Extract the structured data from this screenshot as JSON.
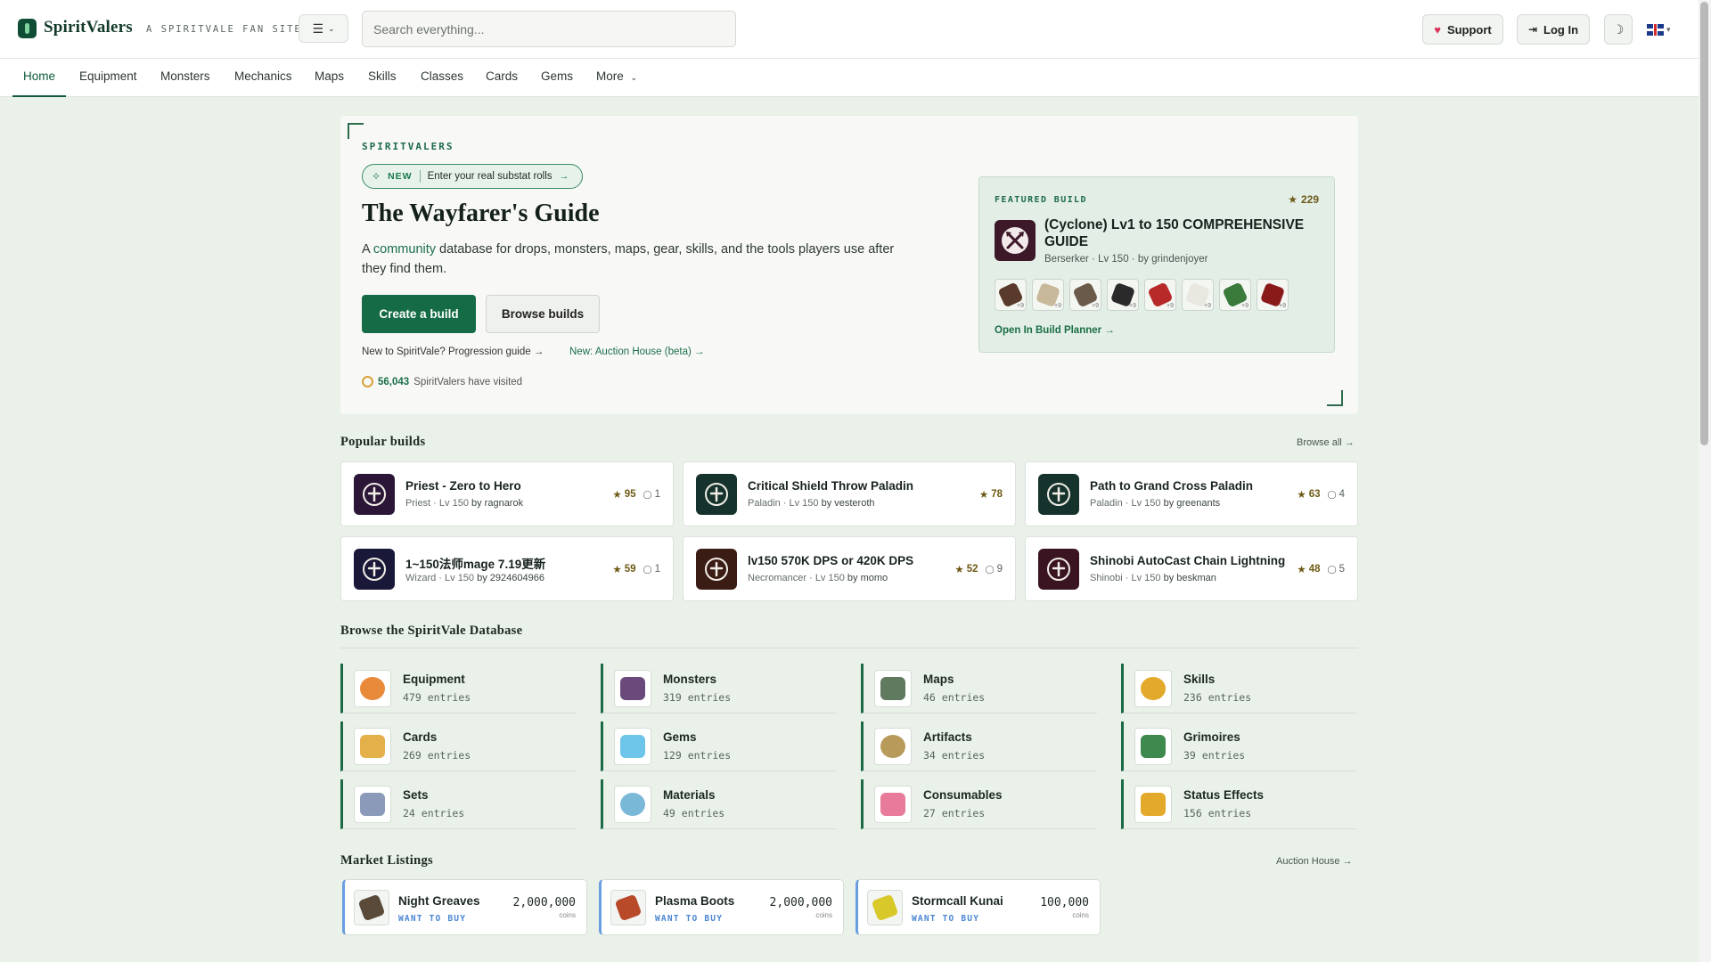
{
  "header": {
    "logo_text": "SpiritValers",
    "tagline": "A SPIRITVALE FAN SITE",
    "search_placeholder": "Search everything...",
    "support_label": "Support",
    "login_label": "Log In",
    "theme_icon": "moon-icon",
    "language": "en-GB"
  },
  "nav": {
    "items": [
      "Home",
      "Equipment",
      "Monsters",
      "Mechanics",
      "Maps",
      "Skills",
      "Classes",
      "Cards",
      "Gems",
      "More"
    ],
    "active": "Home"
  },
  "hero": {
    "eyebrow": "SPIRITVALERS",
    "pill_new": "NEW",
    "pill_text": "Enter your real substat rolls",
    "pill_arrow": "→",
    "title": "The Wayfarer's Guide",
    "desc_prefix": "A ",
    "desc_link": "community",
    "desc_suffix": " database for drops, monsters, maps, gear, skills, and the tools players use after they find them.",
    "create_label": "Create a build",
    "browse_label": "Browse builds",
    "progress_link": "New to SpiritVale? Progression guide →",
    "auction_link": "New: Auction House (beta) →",
    "visited_count": "56,043",
    "visited_suffix": "SpiritValers have visited"
  },
  "featured_build": {
    "label": "FEATURED BUILD",
    "likes": "229",
    "title": "(Cyclone) Lv1 to 150 COMPREHENSIVE GUIDE",
    "meta": "Berserker · Lv 150 · by grindenjoyer",
    "gear_count": 8,
    "open_label": "Open In Build Planner →"
  },
  "popular_builds": {
    "title": "Popular builds",
    "browse_all": "Browse all →",
    "items": [
      {
        "title": "Priest - Zero to Hero",
        "cls": "Priest",
        "lv": "Lv 150",
        "by": "by ragnarok",
        "stars": "95",
        "comments": "1",
        "icon": "holy-book-icon",
        "color": "#2c1638"
      },
      {
        "title": "Critical Shield Throw Paladin",
        "cls": "Paladin",
        "lv": "Lv 150",
        "by": "by vesteroth",
        "stars": "78",
        "comments": "",
        "icon": "shield-cross-icon",
        "color": "#15332c"
      },
      {
        "title": "Path to Grand Cross Paladin",
        "cls": "Paladin",
        "lv": "Lv 150",
        "by": "by greenants",
        "stars": "63",
        "comments": "4",
        "icon": "shield-cross-icon",
        "color": "#15332c"
      },
      {
        "title": "1~150法师mage 7.19更新",
        "cls": "Wizard",
        "lv": "Lv 150",
        "by": "by 2924604966",
        "stars": "59",
        "comments": "1",
        "icon": "wand-icon",
        "color": "#1a1838"
      },
      {
        "title": "lv150 570K DPS or 420K DPS",
        "cls": "Necromancer",
        "lv": "Lv 150",
        "by": "by momo",
        "stars": "52",
        "comments": "9",
        "icon": "skeletal-hand-icon",
        "color": "#3a1c14"
      },
      {
        "title": "Shinobi AutoCast Chain Lightning",
        "cls": "Shinobi",
        "lv": "Lv 150",
        "by": "by beskman",
        "stars": "48",
        "comments": "5",
        "icon": "crossed-blades-icon",
        "color": "#3a1420"
      }
    ]
  },
  "database": {
    "title": "Browse the SpiritVale Database",
    "items": [
      {
        "name": "Equipment",
        "count": "479 entries",
        "icon": "equipment-icon",
        "color": "#e98a3a"
      },
      {
        "name": "Monsters",
        "count": "319 entries",
        "icon": "monster-icon",
        "color": "#6a4a7a"
      },
      {
        "name": "Maps",
        "count": "46 entries",
        "icon": "map-icon",
        "color": "#5f7a5f"
      },
      {
        "name": "Skills",
        "count": "236 entries",
        "icon": "skills-icon",
        "color": "#e3a92a"
      },
      {
        "name": "Cards",
        "count": "269 entries",
        "icon": "card-icon",
        "color": "#e3b04a"
      },
      {
        "name": "Gems",
        "count": "129 entries",
        "icon": "gem-icon",
        "color": "#6ec5ea"
      },
      {
        "name": "Artifacts",
        "count": "34 entries",
        "icon": "artifact-icon",
        "color": "#b89a5a"
      },
      {
        "name": "Grimoires",
        "count": "39 entries",
        "icon": "grimoire-icon",
        "color": "#3e8a4e"
      },
      {
        "name": "Sets",
        "count": "24 entries",
        "icon": "armor-set-icon",
        "color": "#8a9ab8"
      },
      {
        "name": "Materials",
        "count": "49 entries",
        "icon": "materials-icon",
        "color": "#7ab8d8"
      },
      {
        "name": "Consumables",
        "count": "27 entries",
        "icon": "consumable-icon",
        "color": "#e87a9a"
      },
      {
        "name": "Status Effects",
        "count": "156 entries",
        "icon": "status-effect-icon",
        "color": "#e3a92a"
      }
    ]
  },
  "market": {
    "title": "Market Listings",
    "link": "Auction House →",
    "items": [
      {
        "name": "Night Greaves",
        "tag": "WANT TO BUY",
        "price": "2,000,000",
        "unit": "coins",
        "icon": "greaves-icon",
        "color": "#5a4a3a"
      },
      {
        "name": "Plasma Boots",
        "tag": "WANT TO BUY",
        "price": "2,000,000",
        "unit": "coins",
        "icon": "boots-icon",
        "color": "#b84a2a"
      },
      {
        "name": "Stormcall Kunai",
        "tag": "WANT TO BUY",
        "price": "100,000",
        "unit": "coins",
        "icon": "kunai-icon",
        "color": "#d8c82a"
      }
    ]
  }
}
